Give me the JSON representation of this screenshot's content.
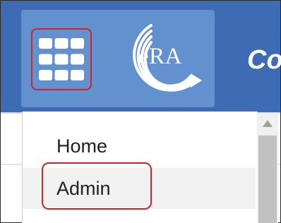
{
  "header": {
    "logo_text": "eRA",
    "app_title": "Co",
    "apps_icon": "grid-9-icon",
    "logo_icon": "era-swoosh-logo"
  },
  "menu": {
    "items": [
      {
        "label": "Home"
      },
      {
        "label": "Admin"
      }
    ]
  },
  "scrollbar": {
    "up_icon": "triangle-up-icon"
  },
  "colors": {
    "header_bg": "#3d6cb4",
    "brand_tile_bg": "#6390cf",
    "highlight_red": "#d2232a",
    "scroll_thumb": "#c1c1c1"
  }
}
